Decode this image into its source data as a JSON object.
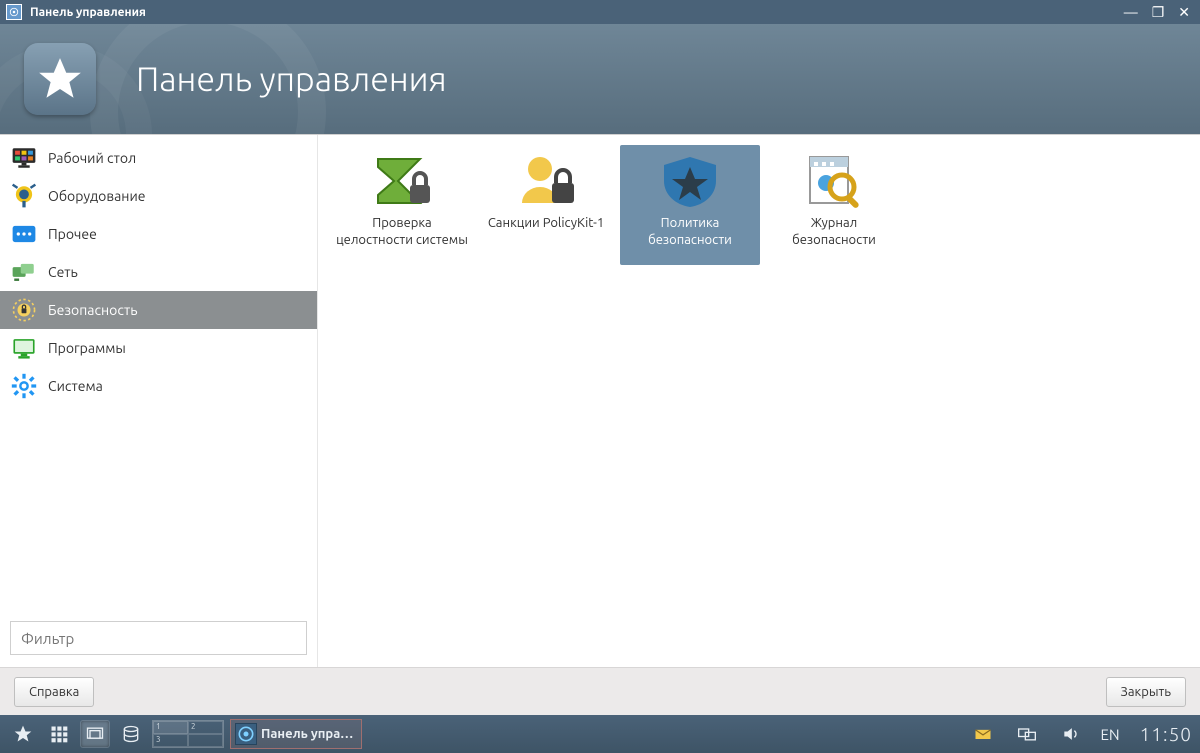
{
  "titlebar": {
    "title": "Панель управления"
  },
  "banner": {
    "heading": "Панель управления"
  },
  "sidebar": {
    "items": [
      {
        "id": "desktop",
        "label": "Рабочий стол"
      },
      {
        "id": "hardware",
        "label": "Оборудование"
      },
      {
        "id": "other",
        "label": "Прочее"
      },
      {
        "id": "network",
        "label": "Сеть"
      },
      {
        "id": "security",
        "label": "Безопасность",
        "selected": true
      },
      {
        "id": "programs",
        "label": "Программы"
      },
      {
        "id": "system",
        "label": "Система"
      }
    ],
    "filter_placeholder": "Фильтр"
  },
  "content": {
    "tiles": [
      {
        "id": "integrity",
        "label": "Проверка целостности системы"
      },
      {
        "id": "policykit",
        "label": "Санкции PolicyKit-1"
      },
      {
        "id": "secpolicy",
        "label": "Политика безопасности",
        "selected": true
      },
      {
        "id": "seclog",
        "label": "Журнал безопасности"
      }
    ]
  },
  "buttons": {
    "help": "Справка",
    "close": "Закрыть"
  },
  "taskbar": {
    "task_label": "Панель упра…",
    "pager": [
      "1",
      "2",
      "3",
      ""
    ],
    "lang": "EN",
    "clock": "11:50"
  }
}
